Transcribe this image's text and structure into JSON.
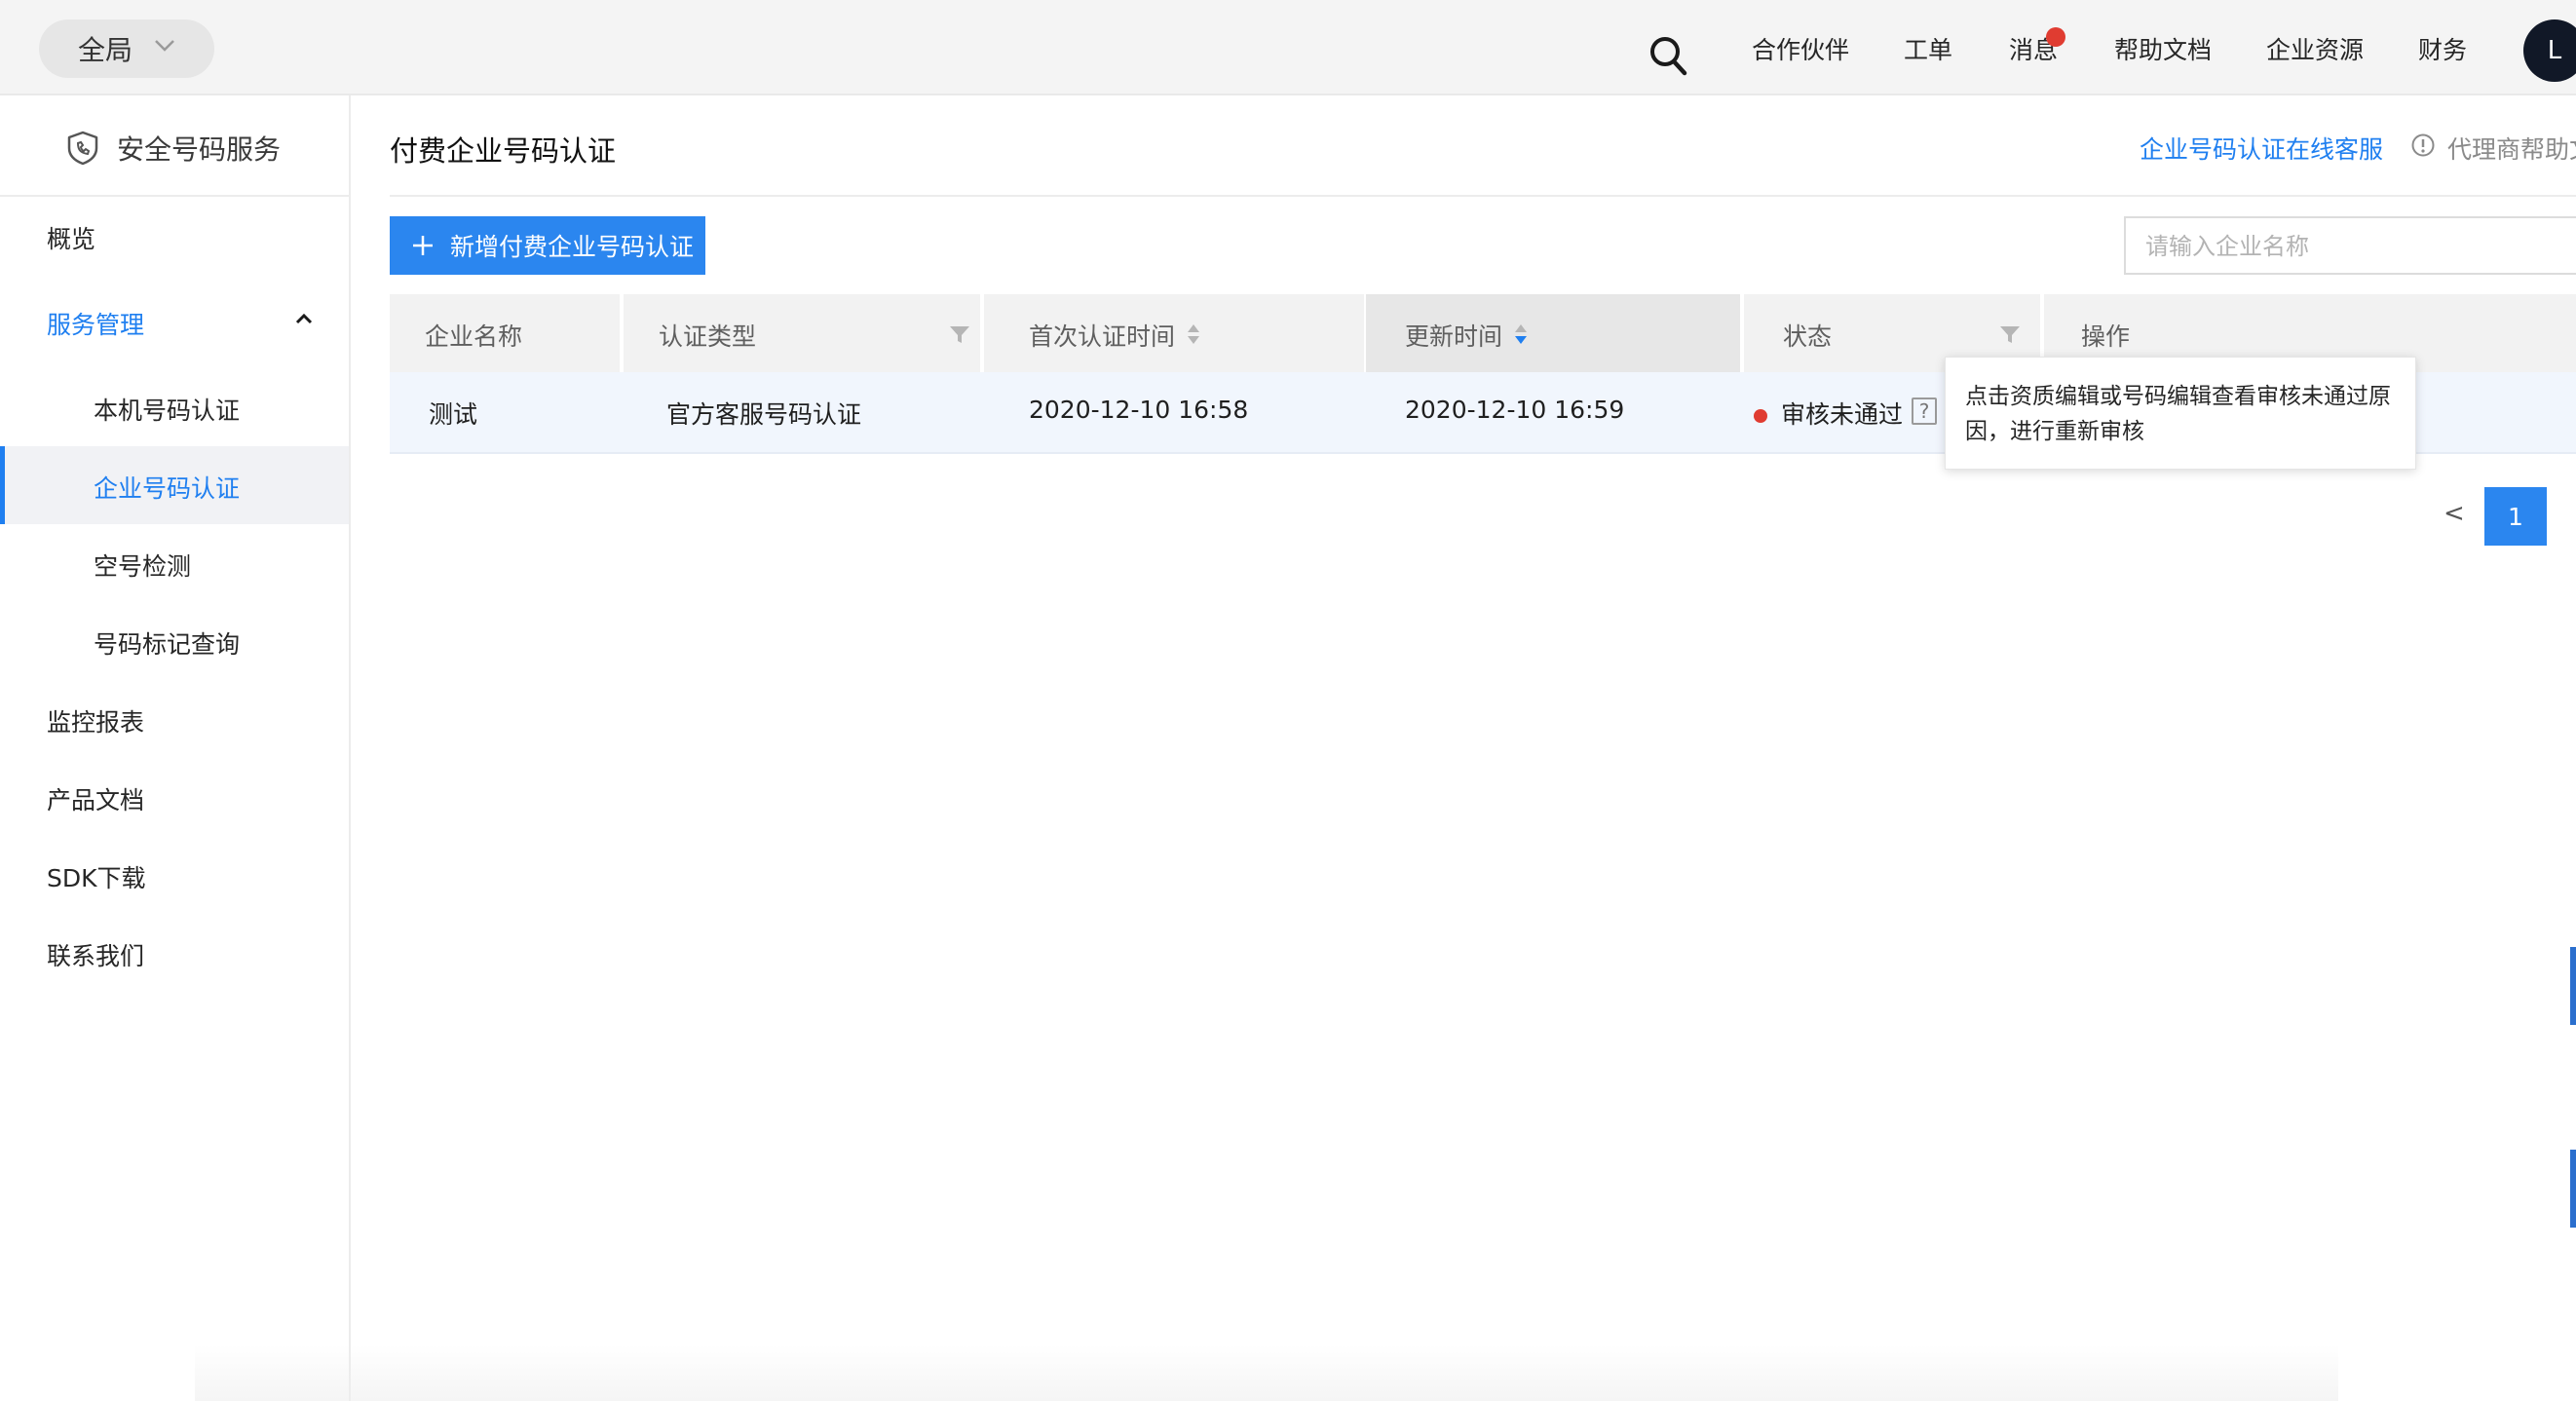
{
  "topbar": {
    "scope_label": "全局",
    "nav": [
      "合作伙伴",
      "工单",
      "消息",
      "帮助文档",
      "企业资源",
      "财务"
    ],
    "user_initial": "L",
    "icons": {
      "search": "search-icon",
      "scope_dropdown": "chevron-down-icon",
      "message_badge": "notification-dot"
    },
    "colors": {
      "badge": "#e03c31",
      "avatar": "#111827"
    }
  },
  "sidebar": {
    "title": "安全号码服务",
    "icon": "shield-phone-icon",
    "items": [
      {
        "label": "概览"
      },
      {
        "label": "服务管理",
        "expanded": true
      },
      {
        "label": "本机号码认证"
      },
      {
        "label": "企业号码认证",
        "active": true
      },
      {
        "label": "空号检测"
      },
      {
        "label": "号码标记查询"
      },
      {
        "label": "监控报表"
      },
      {
        "label": "产品文档"
      },
      {
        "label": "SDK下载"
      },
      {
        "label": "联系我们"
      }
    ]
  },
  "main": {
    "page_title": "付费企业号码认证",
    "service_link": "企业号码认证在线客服",
    "agent_help_link": "代理商帮助文",
    "add_button_label": "新增付费企业号码认证",
    "search_placeholder": "请输入企业名称",
    "table": {
      "columns": [
        "企业名称",
        "认证类型",
        "首次认证时间",
        "更新时间",
        "状态",
        "操作"
      ],
      "sorted_column": "更新时间",
      "rows": [
        {
          "name": "测试",
          "type": "官方客服号码认证",
          "first_time": "2020-12-10 16:58",
          "update_time": "2020-12-10 16:59",
          "status": "审核未通过",
          "status_color": "#e03c31"
        }
      ]
    },
    "tooltip": "点击资质编辑或号码编辑查看审核未通过原因，进行重新审核",
    "pagination": {
      "prev": "<",
      "current": "1"
    }
  },
  "colors": {
    "accent": "#1f7ff0",
    "primary_button": "#2b86ef"
  }
}
